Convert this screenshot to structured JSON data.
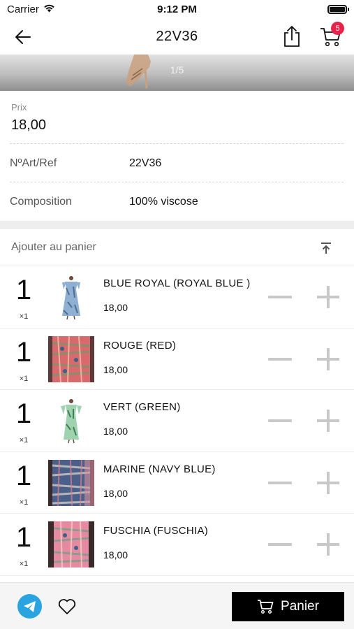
{
  "status_bar": {
    "carrier": "Carrier",
    "time": "9:12 PM"
  },
  "nav": {
    "title": "22V36",
    "cart_count": "5"
  },
  "gallery": {
    "page_indicator": "1/5"
  },
  "product": {
    "price_label": "Prix",
    "price_value": "18,00",
    "ref_label": "NºArt/Ref",
    "ref_value": "22V36",
    "composition_label": "Composition",
    "composition_value": "100% viscose"
  },
  "add_to_cart": {
    "title": "Ajouter au panier"
  },
  "variants": [
    {
      "quantity": "1",
      "unit": "×1",
      "name": "BLUE ROYAL (ROYAL BLUE )",
      "price": "18,00"
    },
    {
      "quantity": "1",
      "unit": "×1",
      "name": "ROUGE (RED)",
      "price": "18,00"
    },
    {
      "quantity": "1",
      "unit": "×1",
      "name": "VERT (GREEN)",
      "price": "18,00"
    },
    {
      "quantity": "1",
      "unit": "×1",
      "name": "MARINE (NAVY BLUE)",
      "price": "18,00"
    },
    {
      "quantity": "1",
      "unit": "×1",
      "name": "FUSCHIA (FUSCHIA)",
      "price": "18,00"
    }
  ],
  "bottom_bar": {
    "panier_label": "Panier"
  },
  "colors": {
    "badge": "#e8234a",
    "telegram": "#2aa3e1",
    "primary_button": "#000000"
  },
  "icons": [
    "wifi-icon",
    "battery-icon",
    "back-arrow-icon",
    "share-icon",
    "cart-icon",
    "scroll-to-top-icon",
    "minus-icon",
    "plus-icon",
    "telegram-icon",
    "heart-icon"
  ]
}
